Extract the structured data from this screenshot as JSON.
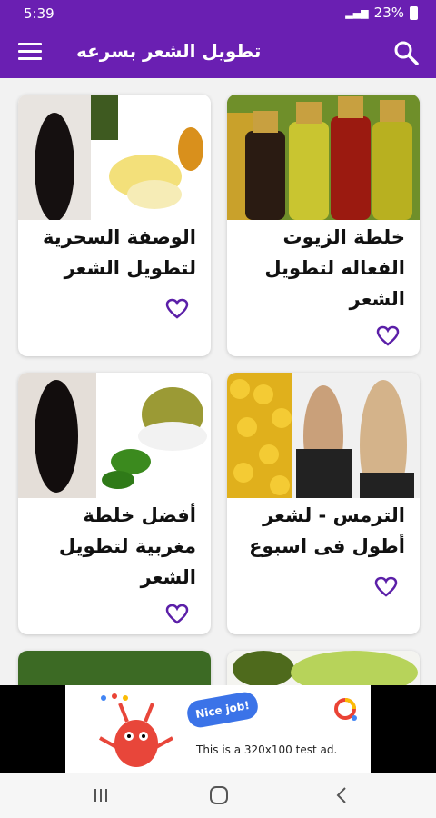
{
  "status": {
    "time": "5:39",
    "battery": "23%"
  },
  "appbar": {
    "title": "تطويل الشعر بسرعه"
  },
  "cards": [
    {
      "title": "خلطة الزيوت الفعاله لتطويل الشعر"
    },
    {
      "title": "الوصفة السحرية لتطويل الشعر"
    },
    {
      "title": "الترمس - لشعر أطول فى اسبوع"
    },
    {
      "title": "أفضل خلطة مغربية لتطويل الشعر"
    }
  ],
  "ad": {
    "bubble": "Nice job!",
    "text": "This is a 320x100 test ad."
  },
  "colors": {
    "primary": "#6a1fb2",
    "heart": "#5b1fa8"
  }
}
